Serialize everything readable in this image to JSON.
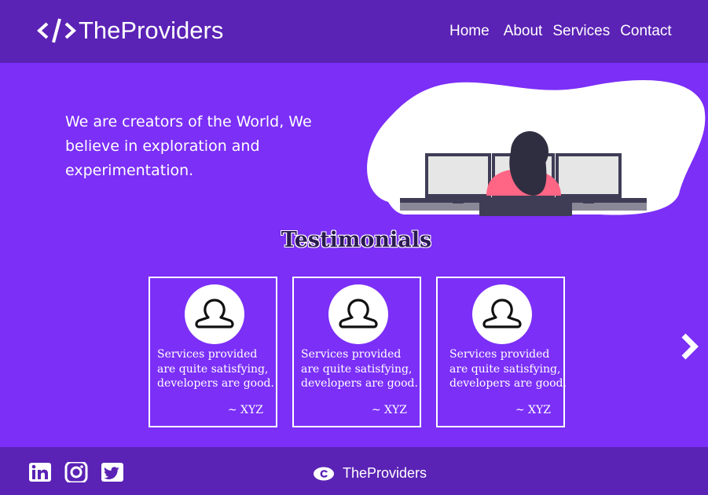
{
  "nav": {
    "brand": "TheProviders",
    "links": [
      "Home",
      "About",
      "Services",
      "Contact"
    ]
  },
  "hero": {
    "text": "We are creators of the World, We believe in exploration and experimentation."
  },
  "testimonials": {
    "title": "Testimonials",
    "cards": [
      {
        "quote": "Services provided are quite satisfying, developers are good.",
        "author": "~ XYZ"
      },
      {
        "quote": "Services provided are quite satisfying, developers are good.",
        "author": "~ XYZ"
      },
      {
        "quote": "Services provided are quite satisfying, developers are good.",
        "author": "~ XYZ"
      }
    ]
  },
  "footer": {
    "brand": "TheProviders",
    "social": [
      "linkedin-icon",
      "instagram-icon",
      "twitter-icon"
    ]
  },
  "colors": {
    "background": "#7b2ff7",
    "nav": "#5a22b5",
    "text": "#ffffff"
  }
}
